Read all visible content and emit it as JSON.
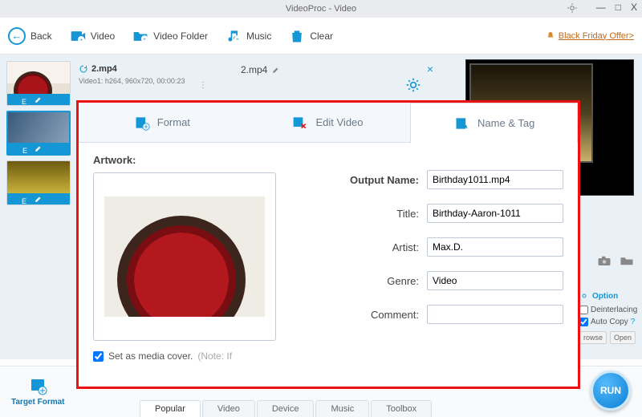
{
  "window": {
    "title": "VideoProc - Video",
    "min": "—",
    "max": "□",
    "close": "X"
  },
  "toolbar": {
    "back": "Back",
    "video": "Video",
    "folder": "Video Folder",
    "music": "Music",
    "clear": "Clear",
    "offer": "Black Friday Offer>"
  },
  "file": {
    "name": "2.mp4",
    "meta": "Video1: h264, 960x720, 00:00:23",
    "center_name": "2.mp4"
  },
  "thumbs": {
    "edit_label": "E"
  },
  "panel": {
    "tabs": {
      "format": "Format",
      "edit": "Edit Video",
      "name": "Name & Tag"
    },
    "artwork_label": "Artwork:",
    "set_cover": "Set as media cover.",
    "set_cover_note": "(Note: If",
    "fields": {
      "output_name": {
        "label": "Output Name:",
        "value": "Birthday1011.mp4"
      },
      "title": {
        "label": "Title:",
        "value": "Birthday-Aaron-1011"
      },
      "artist": {
        "label": "Artist:",
        "value": "Max.D."
      },
      "genre": {
        "label": "Genre:",
        "value": "Video"
      },
      "comment": {
        "label": "Comment:",
        "value": ""
      }
    }
  },
  "options": {
    "header": "Option",
    "deinterlacing": "Deinterlacing",
    "autocopy": "Auto Copy",
    "browse": "rowse",
    "open": "Open"
  },
  "bottom": {
    "target_format": "Target Format",
    "tabs": {
      "popular": "Popular",
      "video": "Video",
      "device": "Device",
      "music": "Music",
      "toolbox": "Toolbox"
    },
    "run": "RUN"
  }
}
